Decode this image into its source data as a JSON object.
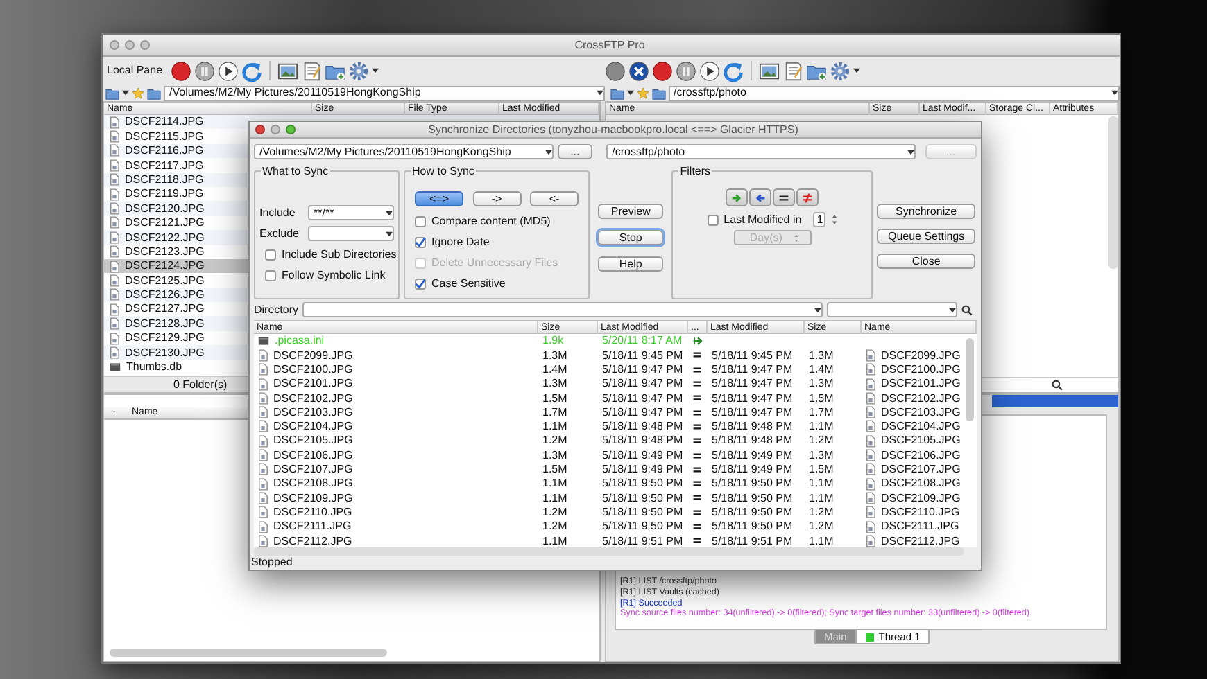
{
  "main_window": {
    "title": "CrossFTP Pro",
    "local_pane": {
      "label": "Local Pane",
      "path": "/Volumes/M2/My Pictures/20110519HongKongShip",
      "columns": [
        "Name",
        "Size",
        "File Type",
        "Last Modified"
      ],
      "files": [
        {
          "name": "DSCF2114.JPG",
          "kind": "image",
          "selected": false
        },
        {
          "name": "DSCF2115.JPG",
          "kind": "image",
          "selected": false
        },
        {
          "name": "DSCF2116.JPG",
          "kind": "image",
          "selected": false
        },
        {
          "name": "DSCF2117.JPG",
          "kind": "image",
          "selected": false
        },
        {
          "name": "DSCF2118.JPG",
          "kind": "image",
          "selected": false
        },
        {
          "name": "DSCF2119.JPG",
          "kind": "image",
          "selected": false
        },
        {
          "name": "DSCF2120.JPG",
          "kind": "image",
          "selected": false
        },
        {
          "name": "DSCF2121.JPG",
          "kind": "image",
          "selected": false
        },
        {
          "name": "DSCF2122.JPG",
          "kind": "image",
          "selected": false
        },
        {
          "name": "DSCF2123.JPG",
          "kind": "image",
          "selected": false
        },
        {
          "name": "DSCF2124.JPG",
          "kind": "image",
          "selected": true
        },
        {
          "name": "DSCF2125.JPG",
          "kind": "image",
          "selected": false
        },
        {
          "name": "DSCF2126.JPG",
          "kind": "image",
          "selected": false
        },
        {
          "name": "DSCF2127.JPG",
          "kind": "image",
          "selected": false
        },
        {
          "name": "DSCF2128.JPG",
          "kind": "image",
          "selected": false
        },
        {
          "name": "DSCF2129.JPG",
          "kind": "image",
          "selected": false
        },
        {
          "name": "DSCF2130.JPG",
          "kind": "image",
          "selected": false
        },
        {
          "name": "Thumbs.db",
          "kind": "data",
          "selected": false
        }
      ],
      "status": "0 Folder(s)"
    },
    "remote_pane": {
      "path": "/crossftp/photo",
      "columns": [
        "Name",
        "Size",
        "Last Modif...",
        "Storage Cl...",
        "Attributes"
      ]
    },
    "queue_pane": {
      "columns": [
        "-",
        "Name"
      ]
    },
    "log": [
      {
        "text": "[R1] LIST /crossftp/photo",
        "kind": "plain"
      },
      {
        "text": "[R1] LIST Vaults (cached)",
        "kind": "plain"
      },
      {
        "text": "[R1] Succeeded",
        "kind": "success"
      },
      {
        "text": "Sync source files number: 34(unfiltered) -> 0(filtered); Sync target files number: 33(unfiltered) -> 0(filtered).",
        "kind": "sync"
      }
    ],
    "log_tabs": [
      {
        "label": "Main",
        "selected": true
      },
      {
        "label": "Thread 1",
        "selected": false,
        "color": "#33cc33"
      }
    ]
  },
  "sync_dialog": {
    "title": "Synchronize Directories (tonyzhou-macbookpro.local <==> Glacier HTTPS)",
    "local_path": "/Volumes/M2/My Pictures/20110519HongKongShip",
    "local_browse": {
      "label": "...",
      "disabled": false
    },
    "remote_path": "/crossftp/photo",
    "remote_browse": {
      "label": "...",
      "disabled": true
    },
    "what_to_sync": {
      "title": "What to Sync",
      "include": {
        "label": "Include",
        "value": "**/**"
      },
      "exclude": {
        "label": "Exclude"
      },
      "options": [
        {
          "label": "Include Sub Directories",
          "checked": false,
          "disabled": false
        },
        {
          "label": "Follow Symbolic Link",
          "checked": false,
          "disabled": false
        }
      ]
    },
    "how_to_sync": {
      "title": "How to Sync",
      "directions": [
        {
          "label": "<=>",
          "selected": true
        },
        {
          "label": "->",
          "selected": false
        },
        {
          "label": "<-",
          "selected": false
        }
      ],
      "options": [
        {
          "label": "Compare content (MD5)",
          "checked": false,
          "disabled": false
        },
        {
          "label": "Ignore Date",
          "checked": true,
          "disabled": false
        },
        {
          "label": "Delete Unnecessary Files",
          "checked": false,
          "disabled": true
        },
        {
          "label": "Case Sensitive",
          "checked": true,
          "disabled": false
        }
      ]
    },
    "actions": [
      {
        "label": "Preview",
        "focused": false
      },
      {
        "label": "Stop",
        "focused": true
      },
      {
        "label": "Help",
        "focused": false
      }
    ],
    "filters": {
      "title": "Filters",
      "buttons": [
        {
          "kind": "right"
        },
        {
          "kind": "left"
        },
        {
          "kind": "equal"
        },
        {
          "kind": "differ"
        }
      ],
      "last_modified": {
        "label": "Last Modified in",
        "checked": false,
        "value": "1"
      },
      "unit": {
        "value": "Day(s)",
        "disabled": true
      }
    },
    "side_buttons": [
      "Synchronize",
      "Queue Settings",
      "Close"
    ],
    "directory_label": "Directory",
    "columns": [
      "Name",
      "Size",
      "Last Modified",
      "...",
      "Last Modified",
      "Size",
      "Name"
    ],
    "rows": [
      {
        "local": {
          "name": ".picasa.ini",
          "kind": "data",
          "size": "1.9k",
          "modified": "5/20/11 8:17 AM"
        },
        "kind": "new"
      },
      {
        "local": {
          "name": "DSCF2099.JPG",
          "kind": "image",
          "size": "1.3M",
          "modified": "5/18/11 9:45 PM"
        },
        "kind": "equal",
        "remote": {
          "name": "DSCF2099.JPG",
          "kind": "image",
          "size": "1.3M",
          "modified": "5/18/11 9:45 PM"
        }
      },
      {
        "local": {
          "name": "DSCF2100.JPG",
          "kind": "image",
          "size": "1.4M",
          "modified": "5/18/11 9:47 PM"
        },
        "kind": "equal",
        "remote": {
          "name": "DSCF2100.JPG",
          "kind": "image",
          "size": "1.4M",
          "modified": "5/18/11 9:47 PM"
        }
      },
      {
        "local": {
          "name": "DSCF2101.JPG",
          "kind": "image",
          "size": "1.3M",
          "modified": "5/18/11 9:47 PM"
        },
        "kind": "equal",
        "remote": {
          "name": "DSCF2101.JPG",
          "kind": "image",
          "size": "1.3M",
          "modified": "5/18/11 9:47 PM"
        }
      },
      {
        "local": {
          "name": "DSCF2102.JPG",
          "kind": "image",
          "size": "1.5M",
          "modified": "5/18/11 9:47 PM"
        },
        "kind": "equal",
        "remote": {
          "name": "DSCF2102.JPG",
          "kind": "image",
          "size": "1.5M",
          "modified": "5/18/11 9:47 PM"
        }
      },
      {
        "local": {
          "name": "DSCF2103.JPG",
          "kind": "image",
          "size": "1.7M",
          "modified": "5/18/11 9:47 PM"
        },
        "kind": "equal",
        "remote": {
          "name": "DSCF2103.JPG",
          "kind": "image",
          "size": "1.7M",
          "modified": "5/18/11 9:47 PM"
        }
      },
      {
        "local": {
          "name": "DSCF2104.JPG",
          "kind": "image",
          "size": "1.1M",
          "modified": "5/18/11 9:48 PM"
        },
        "kind": "equal",
        "remote": {
          "name": "DSCF2104.JPG",
          "kind": "image",
          "size": "1.1M",
          "modified": "5/18/11 9:48 PM"
        }
      },
      {
        "local": {
          "name": "DSCF2105.JPG",
          "kind": "image",
          "size": "1.2M",
          "modified": "5/18/11 9:48 PM"
        },
        "kind": "equal",
        "remote": {
          "name": "DSCF2105.JPG",
          "kind": "image",
          "size": "1.2M",
          "modified": "5/18/11 9:48 PM"
        }
      },
      {
        "local": {
          "name": "DSCF2106.JPG",
          "kind": "image",
          "size": "1.3M",
          "modified": "5/18/11 9:49 PM"
        },
        "kind": "equal",
        "remote": {
          "name": "DSCF2106.JPG",
          "kind": "image",
          "size": "1.3M",
          "modified": "5/18/11 9:49 PM"
        }
      },
      {
        "local": {
          "name": "DSCF2107.JPG",
          "kind": "image",
          "size": "1.5M",
          "modified": "5/18/11 9:49 PM"
        },
        "kind": "equal",
        "remote": {
          "name": "DSCF2107.JPG",
          "kind": "image",
          "size": "1.5M",
          "modified": "5/18/11 9:49 PM"
        }
      },
      {
        "local": {
          "name": "DSCF2108.JPG",
          "kind": "image",
          "size": "1.1M",
          "modified": "5/18/11 9:50 PM"
        },
        "kind": "equal",
        "remote": {
          "name": "DSCF2108.JPG",
          "kind": "image",
          "size": "1.1M",
          "modified": "5/18/11 9:50 PM"
        }
      },
      {
        "local": {
          "name": "DSCF2109.JPG",
          "kind": "image",
          "size": "1.1M",
          "modified": "5/18/11 9:50 PM"
        },
        "kind": "equal",
        "remote": {
          "name": "DSCF2109.JPG",
          "kind": "image",
          "size": "1.1M",
          "modified": "5/18/11 9:50 PM"
        }
      },
      {
        "local": {
          "name": "DSCF2110.JPG",
          "kind": "image",
          "size": "1.2M",
          "modified": "5/18/11 9:50 PM"
        },
        "kind": "equal",
        "remote": {
          "name": "DSCF2110.JPG",
          "kind": "image",
          "size": "1.2M",
          "modified": "5/18/11 9:50 PM"
        }
      },
      {
        "local": {
          "name": "DSCF2111.JPG",
          "kind": "image",
          "size": "1.2M",
          "modified": "5/18/11 9:50 PM"
        },
        "kind": "equal",
        "remote": {
          "name": "DSCF2111.JPG",
          "kind": "image",
          "size": "1.2M",
          "modified": "5/18/11 9:50 PM"
        }
      },
      {
        "local": {
          "name": "DSCF2112.JPG",
          "kind": "image",
          "size": "1.1M",
          "modified": "5/18/11 9:51 PM"
        },
        "kind": "equal",
        "remote": {
          "name": "DSCF2112.JPG",
          "kind": "image",
          "size": "1.1M",
          "modified": "5/18/11 9:51 PM"
        }
      }
    ],
    "status": "Stopped"
  }
}
